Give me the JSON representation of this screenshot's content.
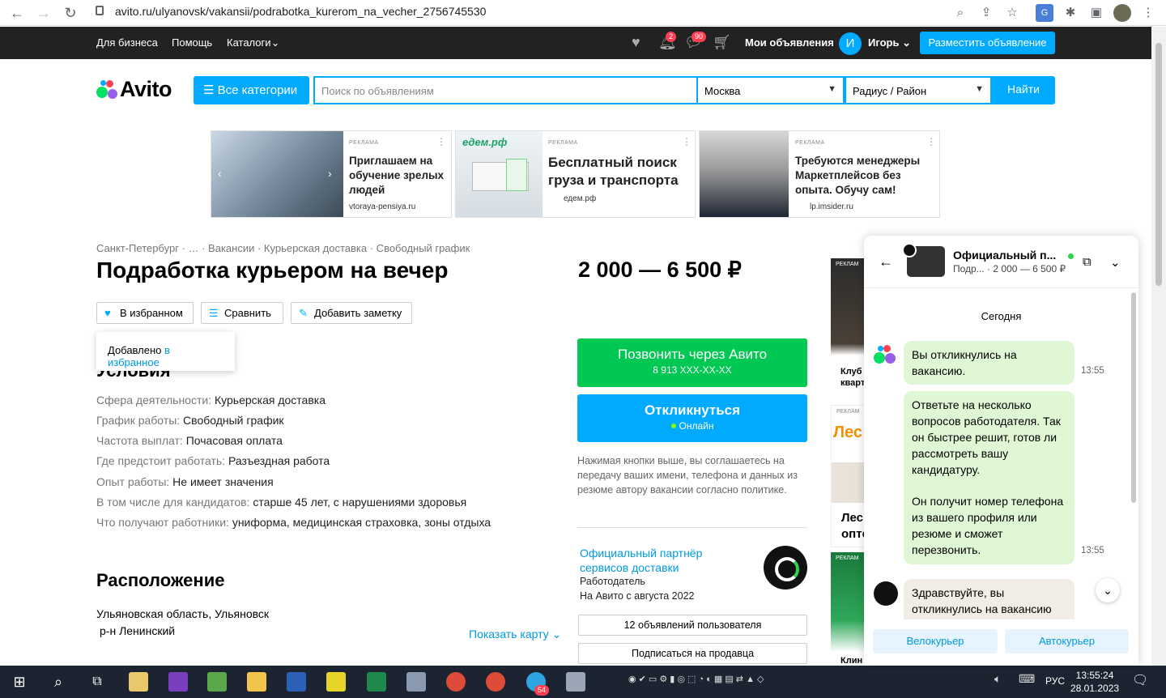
{
  "browser": {
    "url": "avito.ru/ulyanovsk/vakansii/podrabotka_kurerom_na_vecher_2756745530"
  },
  "topbar": {
    "business": "Для бизнеса",
    "help": "Помощь",
    "catalogs": "Каталоги",
    "notif_count": "2",
    "msg_count": "90",
    "my_ads": "Мои объявления",
    "avatar_letter": "И",
    "user": "Игорь",
    "post_ad": "Разместить объявление"
  },
  "header": {
    "logo": "Avito",
    "all_categories": "Все категории",
    "search_placeholder": "Поиск по объявлениям",
    "city": "Москва",
    "radius": "Радиус / Район",
    "find": "Найти"
  },
  "ads": [
    {
      "label": "РЕКЛАМА",
      "text": "Приглашаем на обучение зрелых людей",
      "domain": "vtoraya-pensiya.ru"
    },
    {
      "label": "РЕКЛАМА",
      "brand": "едем.рф",
      "text": "Бесплатный поиск груза и транспорта",
      "domain": "едем.рф"
    },
    {
      "label": "РЕКЛАМА",
      "text": "Требуются менеджеры Маркетплейсов без опыта. Обучу сам!",
      "domain": "lp.imsider.ru"
    }
  ],
  "breadcrumbs": "Санкт-Петербург · … · Вакансии · Курьерская доставка · Свободный график",
  "title": "Подработка курьером на вечер",
  "price": "2 000 — 6 500 ₽",
  "actions": {
    "favorite": "В избранном",
    "compare": "Сравнить",
    "note": "Добавить заметку"
  },
  "tooltip": {
    "text": "Добавлено ",
    "link": "в избранное"
  },
  "conditions_title": "Условия",
  "properties": [
    {
      "k": "Сфера деятельности:",
      "v": "Курьерская доставка"
    },
    {
      "k": "График работы:",
      "v": "Свободный график"
    },
    {
      "k": "Частота выплат:",
      "v": "Почасовая оплата"
    },
    {
      "k": "Где предстоит работать:",
      "v": "Разъездная работа"
    },
    {
      "k": "Опыт работы:",
      "v": "Не имеет значения"
    },
    {
      "k": "В том числе для кандидатов:",
      "v": "старше 45 лет, с нарушениями здоровья"
    },
    {
      "k": "Что получают работники:",
      "v": "униформа, медицинская страховка, зоны отдыха"
    }
  ],
  "location": {
    "title": "Расположение",
    "region": "Ульяновская область, Ульяновск",
    "district": "р-н Ленинский",
    "show_map": "Показать карту"
  },
  "call": {
    "label": "Позвонить через Авито",
    "phone": "8 913 XXX-XX-XX"
  },
  "respond": {
    "label": "Откликнуться",
    "status": "Онлайн"
  },
  "agreement": "Нажимая кнопки выше, вы соглашаетесь на передачу ваших имени, телефона и данных из резюме автору вакансии согласно политике.",
  "seller": {
    "name": "Официальный партнёр сервисов доставки",
    "type": "Работодатель",
    "since": "На Авито с августа 2022",
    "ads_btn": "12 объявлений пользователя",
    "subscribe_btn": "Подписаться на продавца"
  },
  "side_ads": {
    "label": "РЕКЛАМ",
    "club": "Клуб",
    "kvart": "кварт",
    "les": "Лес",
    "les2": "Лес",
    "opt": "опте",
    "klin": "Клин"
  },
  "chat": {
    "name": "Официальный п...",
    "item": "Подр...",
    "price": "2 000 — 6 500 ₽",
    "day": "Сегодня",
    "messages": [
      {
        "text": "Вы откликнулись на вакансию.",
        "time": "13:55"
      },
      {
        "text": "Ответьте на несколько вопросов работодателя. Так он быстрее решит, готов ли рассмотреть вашу кандидатуру.",
        "text2": "Он получит номер телефона из вашего профиля или резюме и сможет перезвонить.",
        "time": "13:55"
      },
      {
        "text": "Здравствуйте, вы откликнулись на вакансию"
      }
    ],
    "quick": [
      "Велокурьер",
      "Автокурьер"
    ]
  },
  "taskbar": {
    "lang": "РУС",
    "time": "13:55:24",
    "date": "28.01.2023",
    "telegram_badge": "54"
  }
}
